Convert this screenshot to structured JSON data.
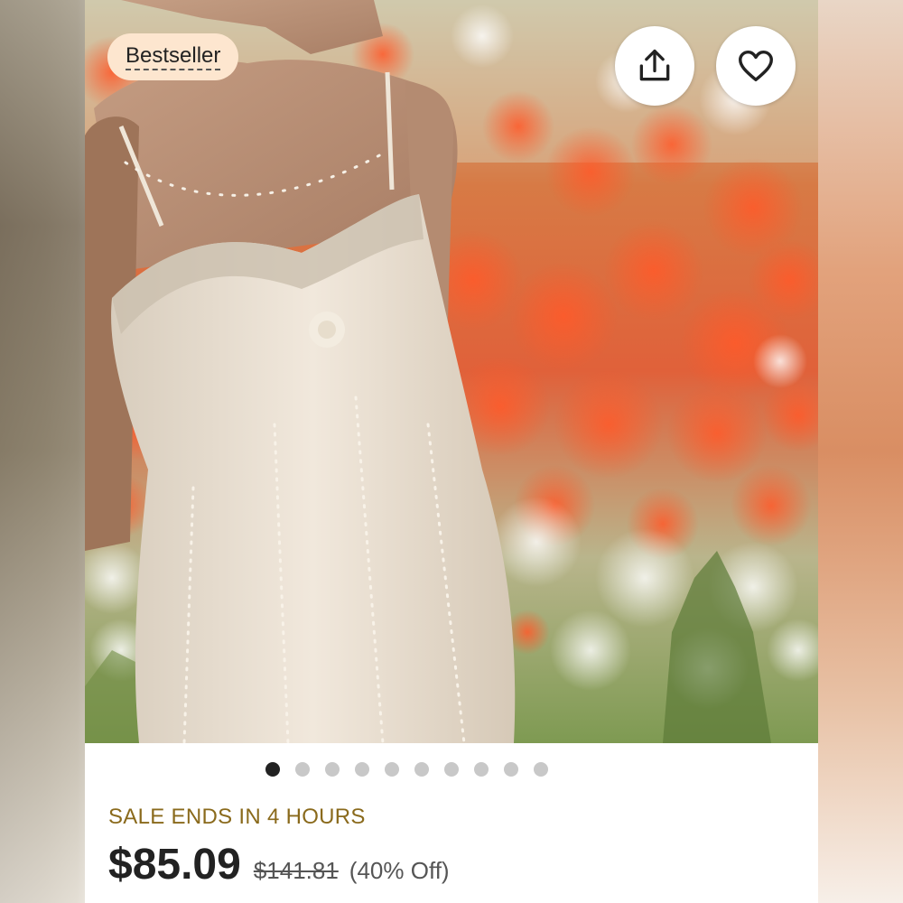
{
  "listing": {
    "badge_label": "Bestseller",
    "image_alt": "Beaded white lace sleeveless dress in a field of red poppies and white flowers",
    "image_count": 10,
    "active_image_index": 0,
    "sale_text": "SALE ENDS IN 4 HOURS",
    "price": "$85.09",
    "original_price": "$141.81",
    "discount": "(40% Off)"
  },
  "actions": {
    "share_icon": "share-icon",
    "favorite_icon": "heart-icon"
  },
  "colors": {
    "badge_bg": "#fde6cf",
    "sale_text": "#8a6a1c",
    "price": "#222222",
    "dot_active": "#222222",
    "dot_inactive": "#c8c8c8"
  }
}
